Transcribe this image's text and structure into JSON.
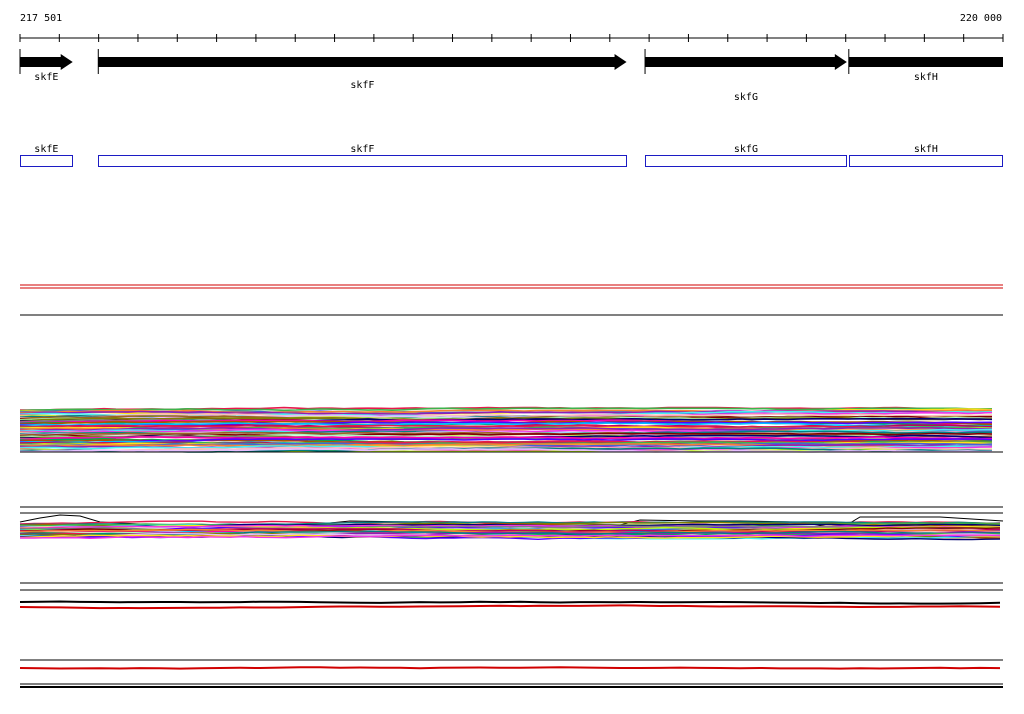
{
  "ruler": {
    "start_label": "217 501",
    "end_label": "220 000",
    "start": 217501,
    "end": 220000
  },
  "genes": [
    {
      "name": "skfE",
      "start": 217501,
      "end": 217635,
      "strand": "+"
    },
    {
      "name": "skfF",
      "start": 217700,
      "end": 219043,
      "strand": "+"
    },
    {
      "name": "skfG",
      "start": 219090,
      "end": 219603,
      "strand": "+"
    },
    {
      "name": "skfH",
      "start": 219608,
      "end": 220000,
      "strand": "+"
    }
  ],
  "colors": {
    "arrow": "#000000",
    "feature_box": "#1c1cc4",
    "red_line": "#d00000",
    "black_line": "#000000"
  }
}
